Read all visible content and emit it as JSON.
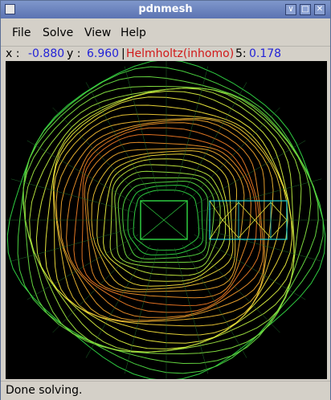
{
  "window": {
    "title": "pdnmesh",
    "buttons": {
      "minimize": "∨",
      "maximize": "□",
      "close": "✕"
    }
  },
  "menu": {
    "items": [
      {
        "label": "File"
      },
      {
        "label": "Solve"
      },
      {
        "label": "View"
      },
      {
        "label": "Help"
      }
    ]
  },
  "coords": {
    "x_label": "x :",
    "x_value": "-0.880",
    "y_label": "y :",
    "y_value": "6.960",
    "separator": "|",
    "equation": "Helmholtz(inhomo)",
    "mode_label": "5:",
    "mode_value": "0.178"
  },
  "status": {
    "message": "Done solving."
  },
  "colors": {
    "accent_blue": "#2323d8",
    "accent_red": "#d11919",
    "mesh_green": "#2ecc40",
    "mesh_yellow": "#e5e53a",
    "mesh_orange": "#e06a20",
    "boundary_cyan": "#22d8d8"
  },
  "icons": {
    "window_icon": "app-window-icon"
  }
}
